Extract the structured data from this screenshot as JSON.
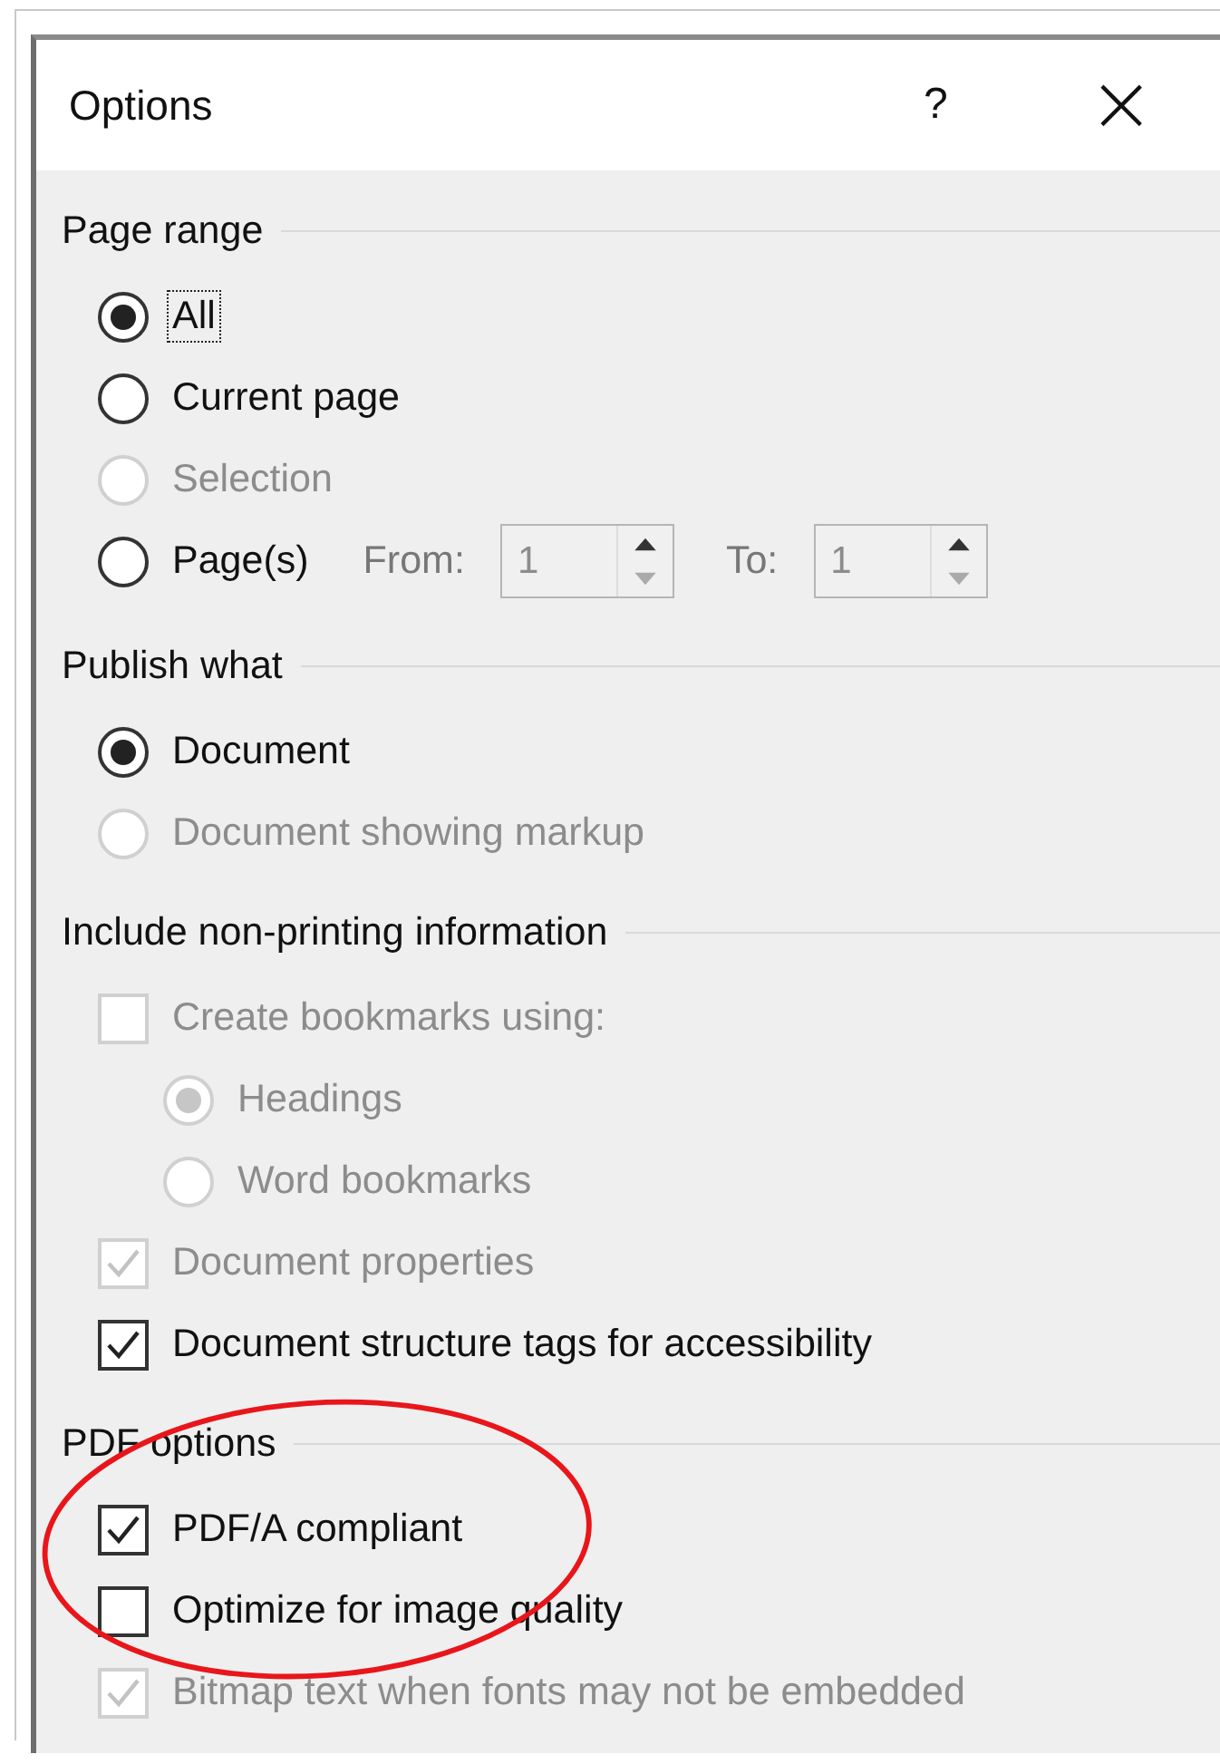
{
  "window": {
    "title": "Options",
    "help": "?",
    "close": "×"
  },
  "sections": [
    {
      "heading": "Page range",
      "items": [
        {
          "kind": "radio",
          "label": "All",
          "selected": true,
          "disabled": false,
          "focused": true
        },
        {
          "kind": "radio",
          "label": "Current page",
          "selected": false,
          "disabled": false
        },
        {
          "kind": "radio",
          "label": "Selection",
          "selected": false,
          "disabled": true
        },
        {
          "kind": "range",
          "label": "Page(s)",
          "selected": false,
          "disabled": false,
          "from_label": "From:",
          "from": "1",
          "to_label": "To:",
          "to": "1"
        }
      ]
    },
    {
      "heading": "Publish what",
      "items": [
        {
          "kind": "radio",
          "label": "Document",
          "selected": true,
          "disabled": false
        },
        {
          "kind": "radio",
          "label": "Document showing markup",
          "selected": false,
          "disabled": true
        }
      ]
    },
    {
      "heading": "Include non-printing information",
      "items": [
        {
          "kind": "checkbox",
          "label": "Create bookmarks using:",
          "checked": false,
          "disabled": true,
          "children": [
            {
              "kind": "radio",
              "label": "Headings",
              "selected": true,
              "disabled": true
            },
            {
              "kind": "radio",
              "label": "Word bookmarks",
              "selected": false,
              "disabled": true
            }
          ]
        },
        {
          "kind": "checkbox",
          "label": "Document properties",
          "checked": true,
          "disabled": true
        },
        {
          "kind": "checkbox",
          "label": "Document structure tags for accessibility",
          "checked": true,
          "disabled": false
        }
      ]
    },
    {
      "heading": "PDF options",
      "items": [
        {
          "kind": "checkbox",
          "label": "PDF/A compliant",
          "checked": true,
          "disabled": false
        },
        {
          "kind": "checkbox",
          "label": "Optimize for image quality",
          "checked": false,
          "disabled": false
        },
        {
          "kind": "checkbox",
          "label": "Bitmap text when fonts may not be embedded",
          "checked": true,
          "disabled": true
        }
      ]
    }
  ],
  "annotation": {
    "kind": "ellipse",
    "color": "#e8161b"
  }
}
